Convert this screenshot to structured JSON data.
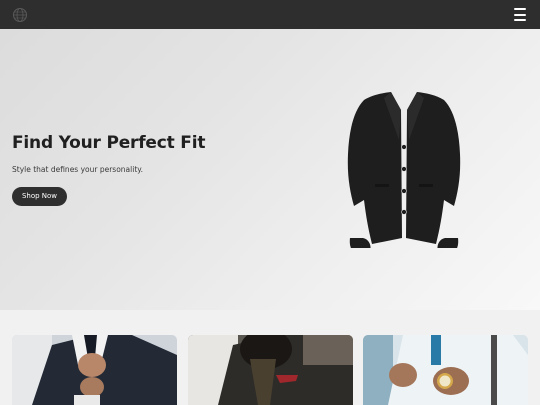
{
  "header": {
    "logo_icon": "globe-logo-icon",
    "menu_icon": "hamburger-menu-icon"
  },
  "hero": {
    "title": "Find Your Perfect Fit",
    "subtitle": "Style that defines your personality.",
    "cta_label": "Shop Now",
    "image_icon": "suit-jacket-icon"
  },
  "products": {
    "cards": [
      {
        "image": "man-in-navy-suit-adjusting-tie-photo"
      },
      {
        "image": "bearded-man-in-dark-suit-with-red-pocket-square-photo"
      },
      {
        "image": "man-in-white-shirt-with-gold-watch-photo"
      }
    ]
  },
  "colors": {
    "topbar": "#2e2e2e",
    "hero_gradient_start": "#dcdcdc",
    "hero_gradient_end": "#f8f8f8",
    "button": "#2f2f2f",
    "text_primary": "#202020"
  }
}
